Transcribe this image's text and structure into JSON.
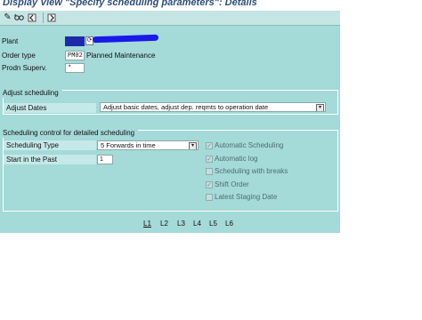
{
  "window": {
    "title": "Display View \"Specify scheduling parameters\": Details"
  },
  "toolbar": {
    "icons": [
      "edit-pen-icon",
      "glasses-display-icon",
      "previous-entry-icon",
      "next-entry-icon"
    ]
  },
  "header_fields": {
    "plant_label": "Plant",
    "order_type_label": "Order type",
    "order_type_value": "PM02",
    "order_type_desc": "Planned Maintenance",
    "prodn_superv_label": "Prodn Superv.",
    "prodn_superv_value": "*"
  },
  "adjust_scheduling": {
    "title": "Adjust scheduling",
    "adjust_dates_label": "Adjust Dates",
    "adjust_dates_value": "Adjust basic dates, adjust dep. reqmts to operation date"
  },
  "sched_control": {
    "title": "Scheduling control for detailed scheduling",
    "type_label": "Scheduling Type",
    "type_value": "5 Forwards in time",
    "start_past_label": "Start in the Past",
    "start_past_value": "1",
    "checkboxes": [
      {
        "label": "Automatic Scheduling",
        "checked": true
      },
      {
        "label": "Automatic log",
        "checked": true
      },
      {
        "label": "Scheduling with breaks",
        "checked": false
      },
      {
        "label": "Shift Order",
        "checked": true
      },
      {
        "label": "Latest Staging Date",
        "checked": false
      }
    ]
  },
  "levels": [
    "L1",
    "L2",
    "L3",
    "L4",
    "L5",
    "L6"
  ],
  "dropdown_arrow": "▾",
  "check_mark": "✓"
}
